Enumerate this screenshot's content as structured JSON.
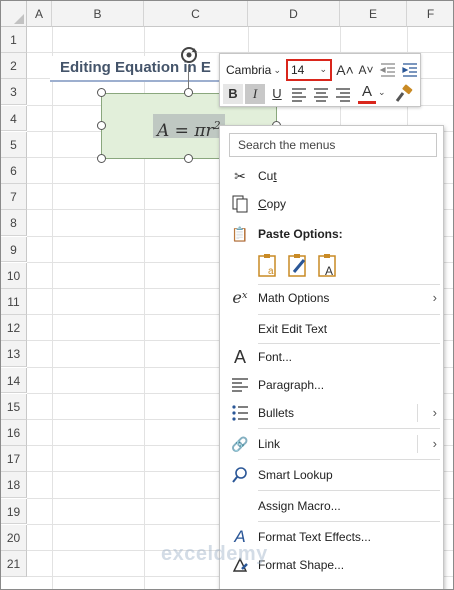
{
  "sheet": {
    "columns": [
      "A",
      "B",
      "C",
      "D",
      "E",
      "F"
    ],
    "rows": [
      "1",
      "2",
      "3",
      "4",
      "5",
      "6",
      "7",
      "8",
      "9",
      "10",
      "11",
      "12",
      "13",
      "14",
      "15",
      "16",
      "17",
      "18",
      "19",
      "20",
      "21"
    ],
    "title": "Editing Equation in E"
  },
  "equation": {
    "base": "A = πr",
    "exponent": "2"
  },
  "minibar": {
    "font_name": "Cambria",
    "font_size": "14",
    "icons": [
      "grow-font-icon",
      "shrink-font-icon",
      "decrease-indent-icon",
      "increase-indent-icon",
      "bold-icon",
      "italic-icon",
      "underline-icon",
      "align-left-icon",
      "align-center-icon",
      "align-right-icon",
      "font-color-icon",
      "format-painter-icon"
    ],
    "bold": "B",
    "italic": "I",
    "underline": "U",
    "font_color_letter": "A",
    "grow_symbol": "A˄",
    "shrink_symbol": "A˅"
  },
  "menu": {
    "search_placeholder": "Search the menus",
    "items": [
      {
        "label": "Cut",
        "accel": "t",
        "icon": "scissors-icon"
      },
      {
        "label": "Copy",
        "accel": "C",
        "icon": "copy-icon"
      },
      {
        "label": "Paste Options:",
        "icon": "paste-icon"
      },
      {
        "label": "Math Options",
        "icon": "math-options-icon",
        "submenu": true
      },
      {
        "label": "Exit Edit Text"
      },
      {
        "label": "Font...",
        "icon": "font-icon"
      },
      {
        "label": "Paragraph...",
        "icon": "paragraph-icon"
      },
      {
        "label": "Bullets",
        "icon": "bullets-icon",
        "submenu": true
      },
      {
        "label": "Link",
        "icon": "link-icon",
        "submenu": true
      },
      {
        "label": "Smart Lookup",
        "icon": "search-icon"
      },
      {
        "label": "Assign Macro..."
      },
      {
        "label": "Format Text Effects...",
        "icon": "text-effects-icon"
      },
      {
        "label": "Format Shape...",
        "icon": "format-shape-icon"
      }
    ],
    "paste_options": [
      "paste-keep-formatting-icon",
      "paste-merge-formatting-icon",
      "paste-text-only-icon"
    ]
  },
  "watermark": "exceldemy",
  "colors": {
    "shape_fill": "#e2efda",
    "title_text": "#44546a",
    "font_size_outline": "#d9261c",
    "font_color_bar": "#d9261c"
  }
}
